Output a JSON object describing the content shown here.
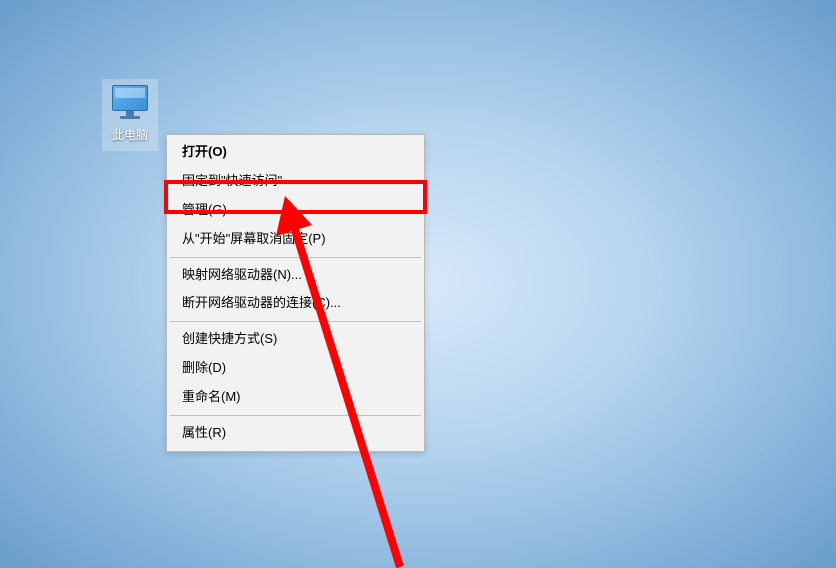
{
  "desktop": {
    "icon_label": "此电脑"
  },
  "context_menu": {
    "items": [
      {
        "label": "打开(O)",
        "bold": true
      },
      {
        "label": "固定到\"快速访问\""
      },
      {
        "label": "管理(G)",
        "highlighted": true
      },
      {
        "label": "从\"开始\"屏幕取消固定(P)"
      },
      {
        "separator": true
      },
      {
        "label": "映射网络驱动器(N)..."
      },
      {
        "label": "断开网络驱动器的连接(C)..."
      },
      {
        "separator": true
      },
      {
        "label": "创建快捷方式(S)"
      },
      {
        "label": "删除(D)"
      },
      {
        "label": "重命名(M)"
      },
      {
        "separator": true
      },
      {
        "label": "属性(R)"
      }
    ]
  },
  "annotation": {
    "highlight_color": "#ff0000"
  }
}
